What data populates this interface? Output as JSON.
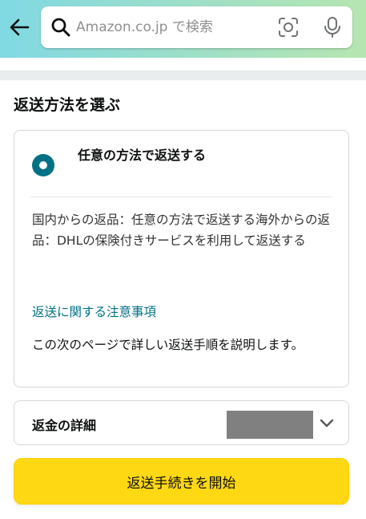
{
  "header": {
    "back_icon": "arrow-left-icon",
    "search": {
      "placeholder": "Amazon.co.jp で検索",
      "value": "",
      "icons": [
        "search-icon",
        "camera-icon",
        "microphone-icon"
      ]
    },
    "gradient": [
      "#80d9e3",
      "#b6e6b0"
    ]
  },
  "page": {
    "title": "返送方法を選ぶ"
  },
  "return_option": {
    "selected": true,
    "label": "任意の方法で返送する",
    "description": "国内からの返品：任意の方法で返送する海外からの返品：DHLの保険付きサービスを利用して返送する",
    "notes_link": "返送に関する注意事項",
    "next_info": "この次のページで詳しい返送手順を説明します。"
  },
  "refund": {
    "label": "返金の詳細",
    "value_redacted": true,
    "expand_icon": "chevron-down-icon"
  },
  "actions": {
    "start_button": "返送手続きを開始"
  },
  "colors": {
    "accent": "#007185",
    "primary_button": "#ffd814",
    "redaction": "#808080"
  }
}
